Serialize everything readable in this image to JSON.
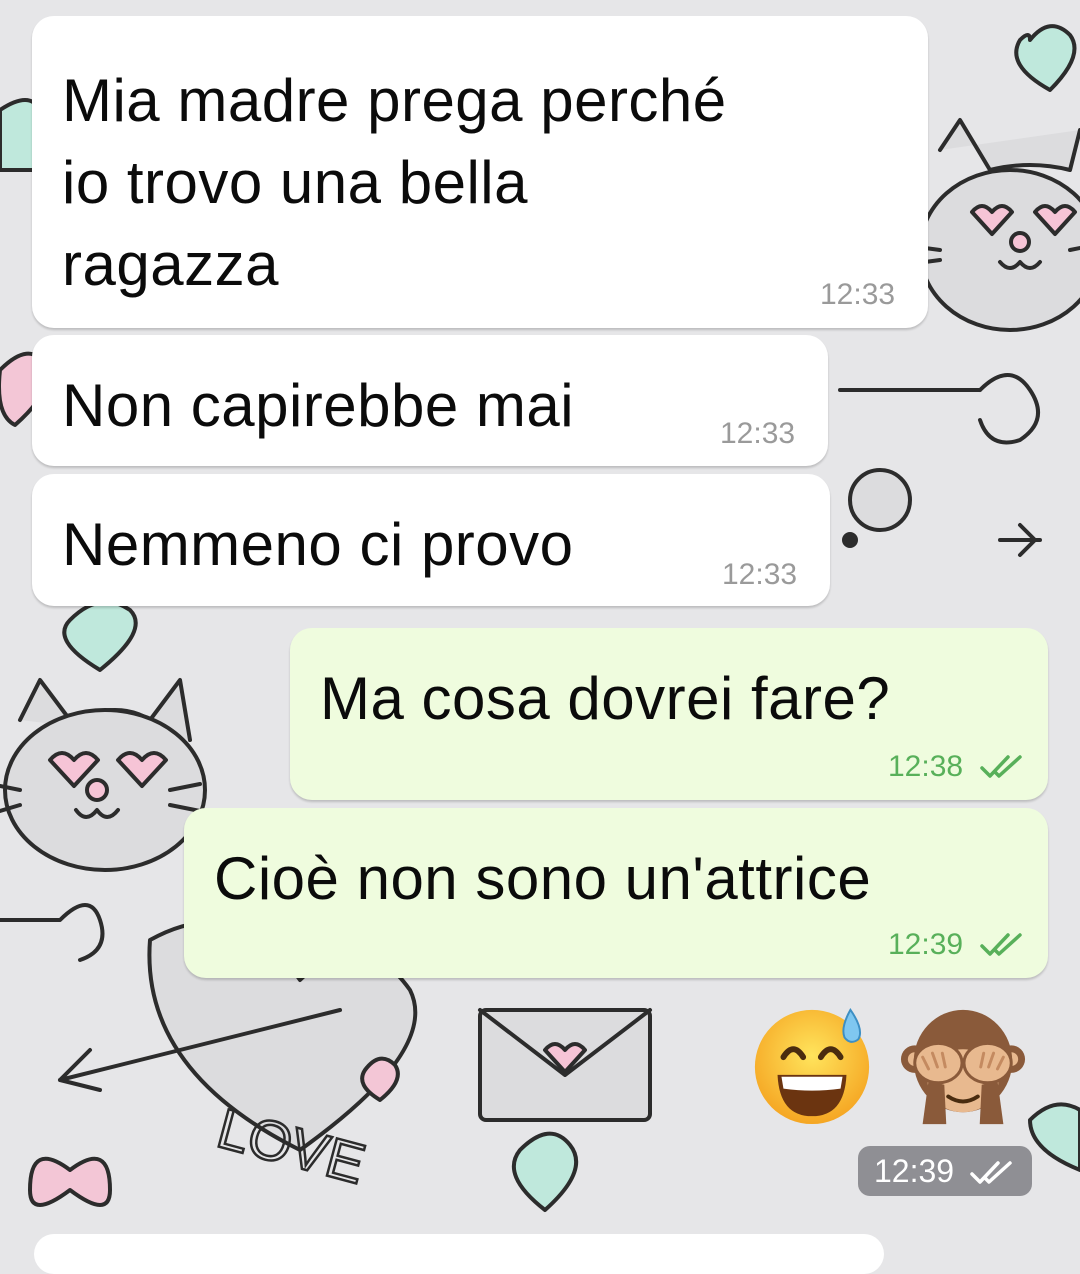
{
  "messages": [
    {
      "text": "Mia madre prega perché\nio trovo una bella\nragazza",
      "time": "12:33",
      "direction": "incoming"
    },
    {
      "text": "Non capirebbe mai",
      "time": "12:33",
      "direction": "incoming"
    },
    {
      "text": "Nemmeno ci provo",
      "time": "12:33",
      "direction": "incoming"
    },
    {
      "text": "Ma cosa dovrei fare?",
      "time": "12:38",
      "direction": "outgoing",
      "status_icon": "double-check-icon"
    },
    {
      "text": "Cioè non sono un'attrice",
      "time": "12:39",
      "direction": "outgoing",
      "status_icon": "double-check-icon"
    }
  ],
  "emoji_message": {
    "emojis": [
      "grinning-face-with-sweat-icon",
      "see-no-evil-monkey-icon"
    ],
    "time": "12:39",
    "status_icon": "double-check-icon"
  },
  "wallpaper": {
    "theme": "cats-hearts-doodle",
    "text": "LOVE"
  },
  "colors": {
    "incoming_bubble": "#ffffff",
    "outgoing_bubble": "#effcde",
    "outgoing_time": "#58b05a",
    "incoming_time": "#9a9a9a",
    "background": "#e6e6e8"
  }
}
